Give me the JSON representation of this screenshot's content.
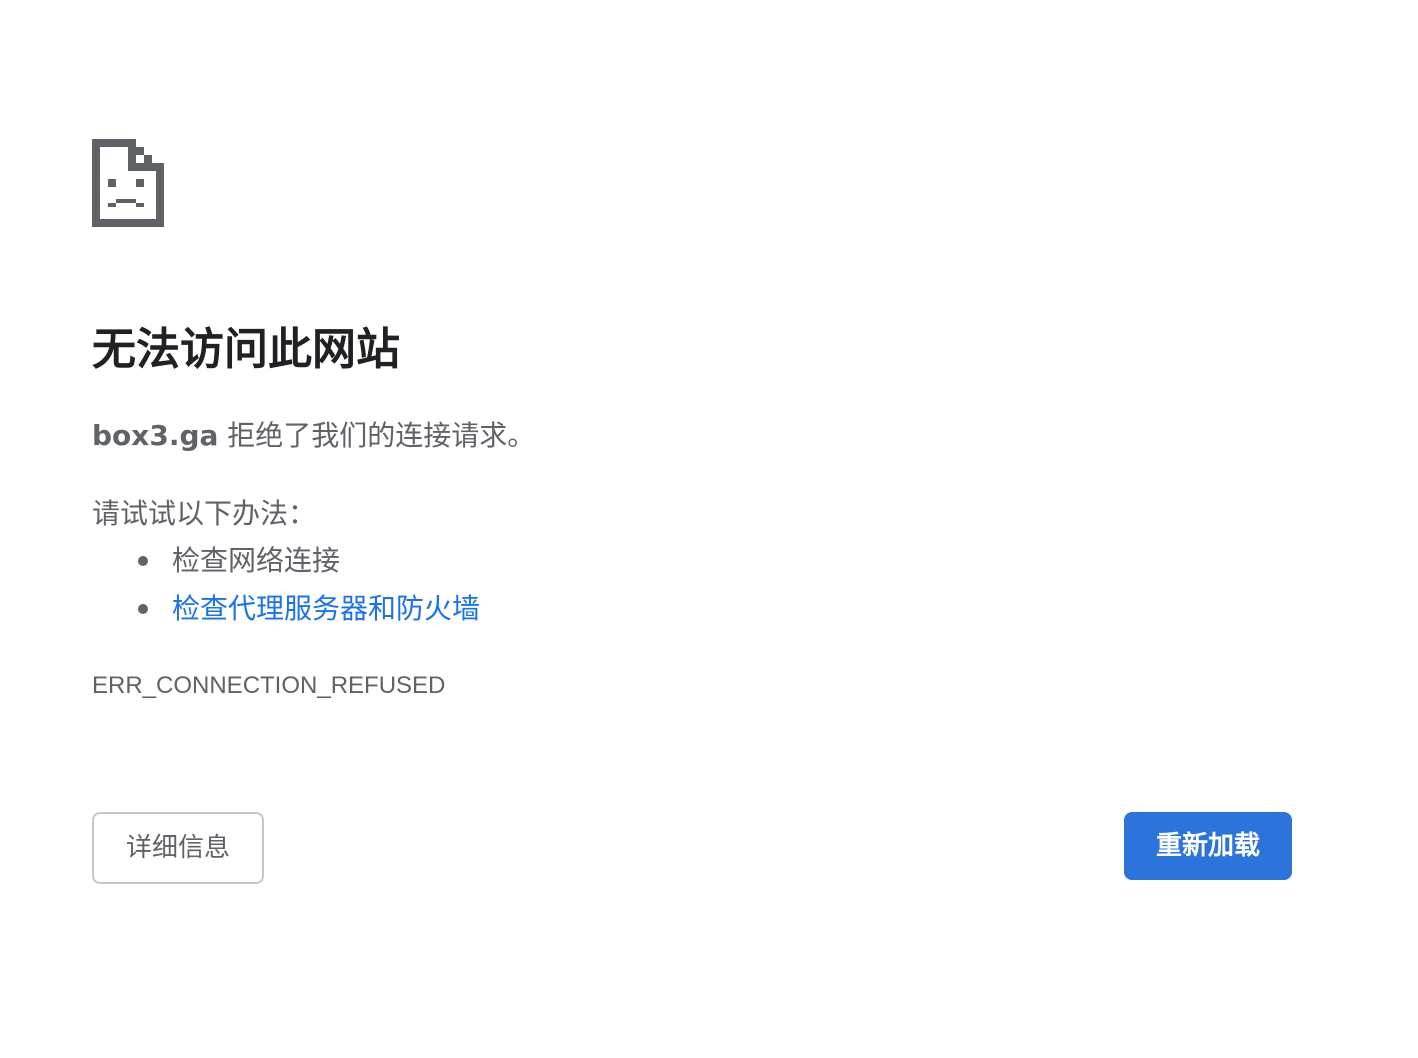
{
  "icon": "sad-page-icon",
  "heading": "无法访问此网站",
  "summary": {
    "host": "box3.ga",
    "message": " 拒绝了我们的连接请求。"
  },
  "suggestions": {
    "heading": "请试试以下办法：",
    "items": [
      {
        "label": "检查网络连接",
        "is_link": false
      },
      {
        "label": "检查代理服务器和防火墙",
        "is_link": true
      }
    ]
  },
  "error_code": "ERR_CONNECTION_REFUSED",
  "buttons": {
    "details": "详细信息",
    "reload": "重新加载"
  },
  "colors": {
    "link": "#1a73e8",
    "primary_button": "#2c73dc",
    "text": "#5f6368",
    "heading": "#202124"
  }
}
